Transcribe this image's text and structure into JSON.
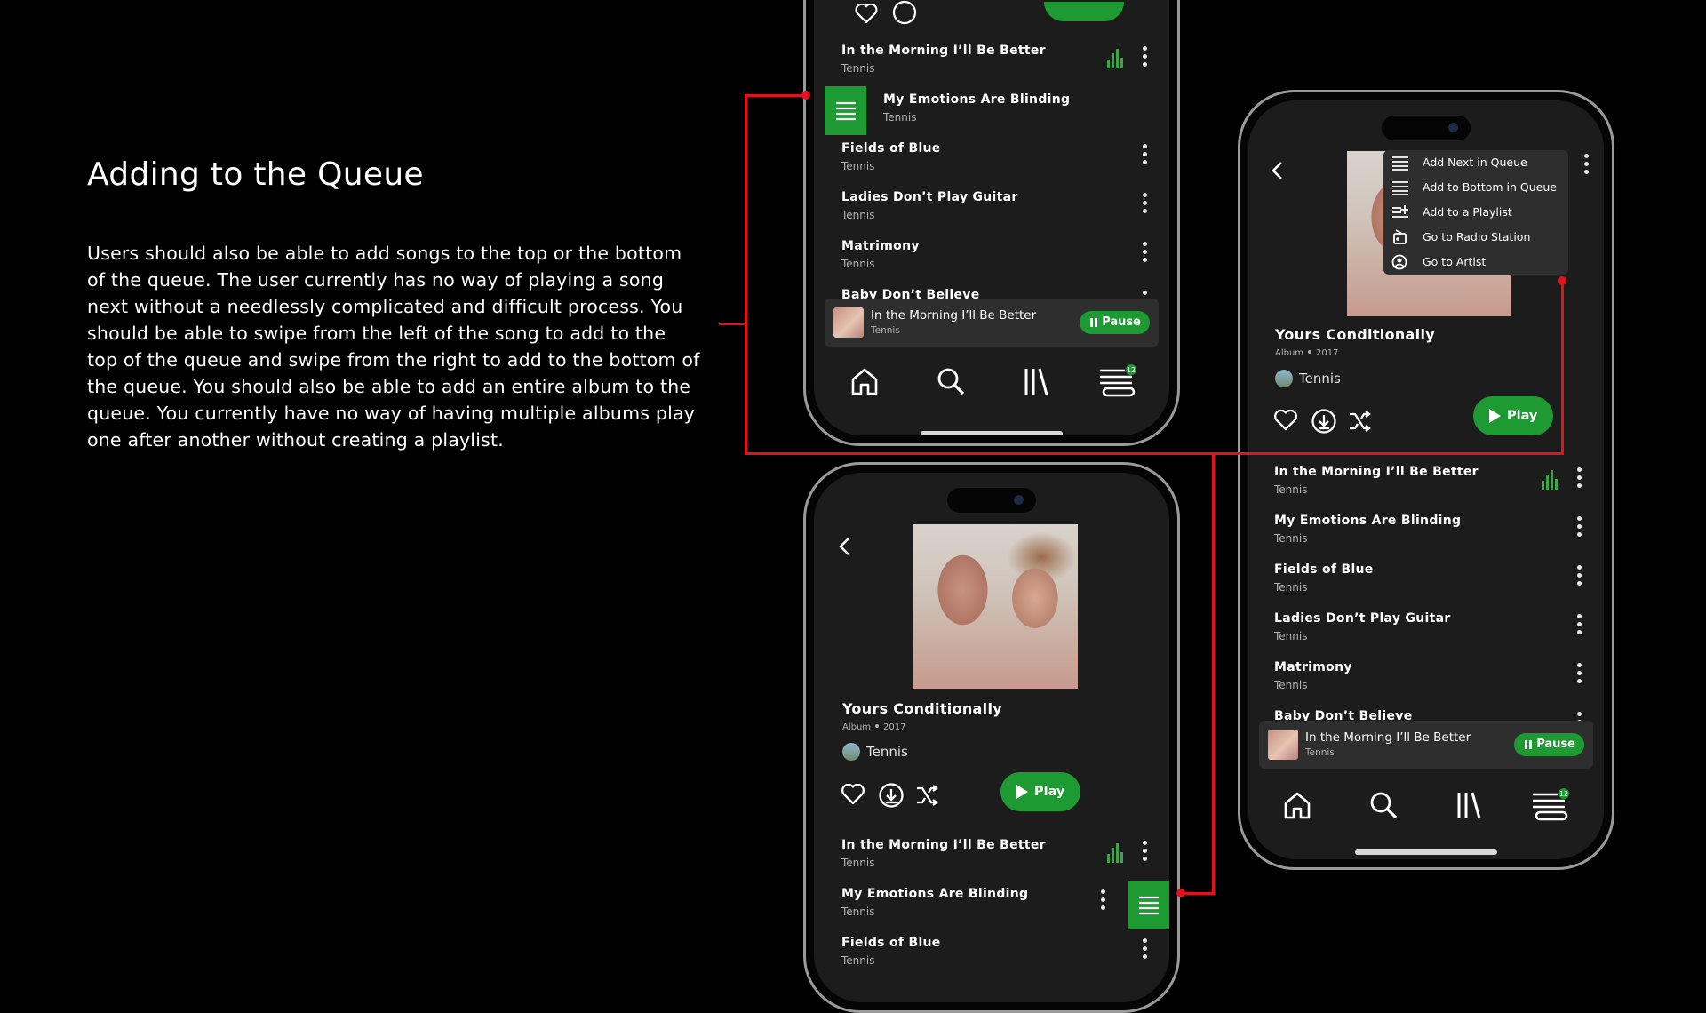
{
  "slide": {
    "heading": "Adding to the Queue",
    "body": "Users should also be able to add songs to the top or the bottom of the queue. The user currently has no way of playing a song next without a needlessly complicated and difficult process. You should be able to swipe from the left of the song to add to the top of the queue and swipe from the right to add to the bottom of the queue. You should also be able to add an entire album to the queue. You currently have no way of having multiple albums play one after another without creating a playlist."
  },
  "album": {
    "title": "Yours Conditionally",
    "type": "Album",
    "year": "2017",
    "artist": "Tennis",
    "play_label": "Play"
  },
  "tracks": [
    {
      "title": "In the Morning I’ll Be Better",
      "artist": "Tennis"
    },
    {
      "title": "My Emotions Are Blinding",
      "artist": "Tennis"
    },
    {
      "title": "Fields of Blue",
      "artist": "Tennis"
    },
    {
      "title": "Ladies Don’t Play Guitar",
      "artist": "Tennis"
    },
    {
      "title": "Matrimony",
      "artist": "Tennis"
    },
    {
      "title": "Baby Don’t Believe",
      "artist": "Tennis"
    }
  ],
  "now_playing": {
    "title": "In the Morning I’ll Be Better",
    "artist": "Tennis",
    "pause_label": "Pause"
  },
  "nav": {
    "items": [
      "home-icon",
      "search-icon",
      "library-icon",
      "queue-icon"
    ],
    "queue_badge": "12"
  },
  "context_menu": {
    "items": [
      {
        "label": "Add Next in Queue",
        "icon": "queue-top-icon"
      },
      {
        "label": "Add to Bottom in Queue",
        "icon": "queue-bottom-icon"
      },
      {
        "label": "Add to a Playlist",
        "icon": "playlist-add-icon"
      },
      {
        "label": "Go to Radio Station",
        "icon": "radio-icon"
      },
      {
        "label": "Go to Artist",
        "icon": "artist-icon"
      }
    ]
  },
  "colors": {
    "background": "#000000",
    "screen": "#1c1c1c",
    "accent_green": "#1e9a32",
    "annotation_red": "#e0141c"
  }
}
